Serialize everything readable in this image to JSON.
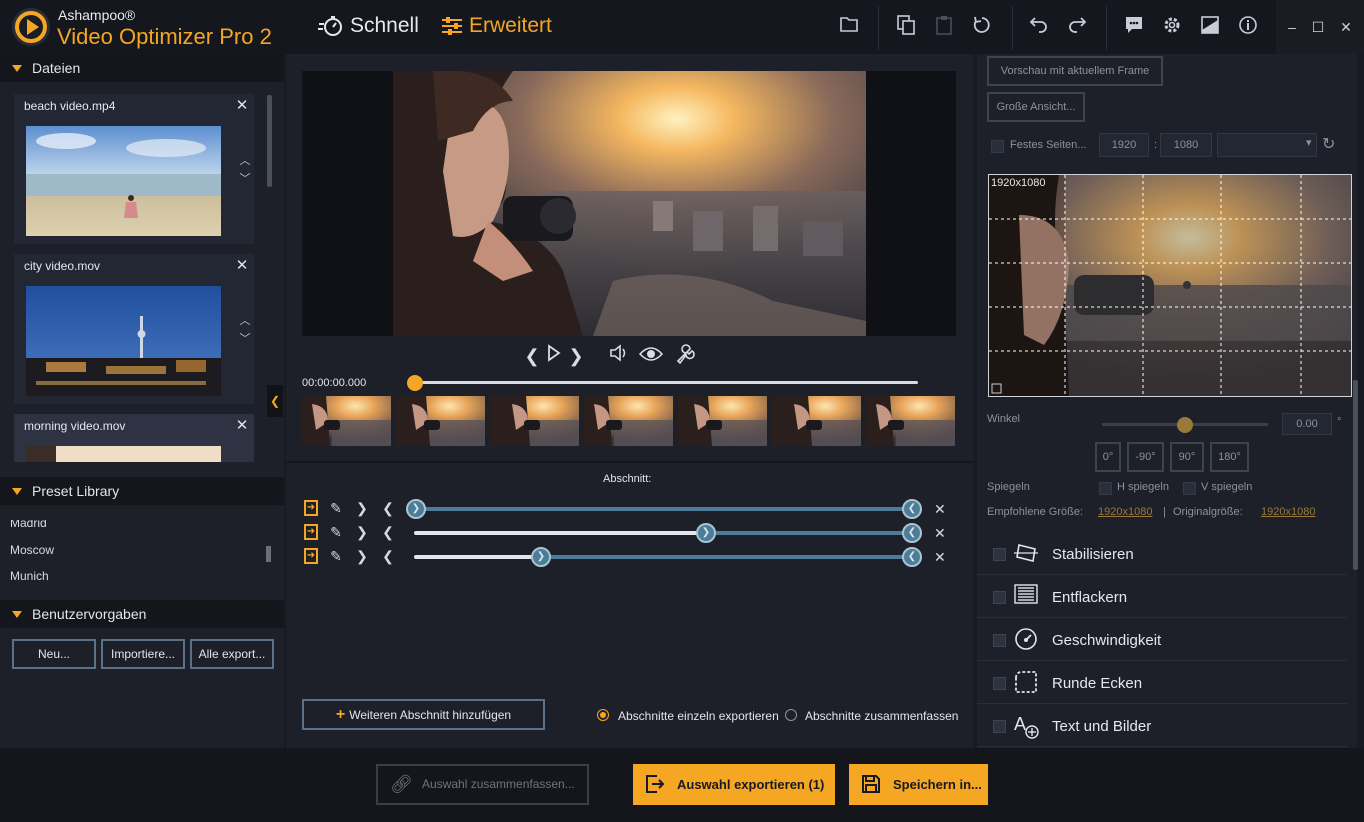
{
  "app": {
    "brand_top": "Ashampoo®",
    "brand_main": "Video Optimizer Pro 2",
    "tabs": [
      {
        "label": "Schnell",
        "icon": "stopwatch-icon"
      },
      {
        "label": "Erweitert",
        "icon": "sliders-icon"
      }
    ],
    "accent_color": "#f5a623"
  },
  "toolbar_icons": [
    "folder-icon",
    "copy-icon",
    "clipboard-icon",
    "reset-icon",
    "undo-icon",
    "redo-icon",
    "chat-icon",
    "gear-icon",
    "image-icon",
    "info-icon"
  ],
  "left": {
    "files_header": "Dateien",
    "files": [
      {
        "name": "beach video.mp4"
      },
      {
        "name": "city video.mov"
      },
      {
        "name": "morning video.mov"
      }
    ],
    "preset_header": "Preset Library",
    "presets": [
      "Madrid",
      "Moscow",
      "Munich"
    ],
    "user_header": "Benutzervorgaben",
    "buttons": {
      "new": "Neu...",
      "import": "Importiere...",
      "export": "Alle export..."
    }
  },
  "center": {
    "timecode": "00:00:00.000",
    "playback_progress": 0,
    "section_label": "Abschnitt:",
    "segments": [
      {
        "start": 0.0,
        "end": 1.0
      },
      {
        "start": 0.58,
        "end": 1.0
      },
      {
        "start": 0.25,
        "end": 1.0
      }
    ],
    "add_section": "Weiteren Abschnitt hinzufügen",
    "radio_separate": "Abschnitte einzeln exportieren",
    "radio_merge": "Abschnitte zusammenfassen",
    "radio_selected": "separate"
  },
  "right": {
    "preview_frame_btn": "Vorschau mit aktuellem Frame",
    "large_view_btn": "Große Ansicht...",
    "fixed_ratio_label": "Festes Seiten...",
    "width": "1920",
    "colon": ":",
    "height": "1080",
    "crop_label": "1920x1080",
    "angle_label": "Winkel",
    "angle_value": "0.00",
    "degree_symbol": "°",
    "angle_level": 0.5,
    "angle_buttons": [
      "0°",
      "-90°",
      "90°",
      "180°"
    ],
    "mirror_label": "Spiegeln",
    "h_mirror": "H spiegeln",
    "v_mirror": "V spiegeln",
    "recommended_label": "Empfohlene Größe:",
    "recommended_value": "1920x1080",
    "separator": "|",
    "original_label": "Originalgröße:",
    "original_value": "1920x1080",
    "features": [
      {
        "label": "Stabilisieren",
        "icon": "stabilize-icon"
      },
      {
        "label": "Entflackern",
        "icon": "deflicker-icon"
      },
      {
        "label": "Geschwindigkeit",
        "icon": "speedometer-icon"
      },
      {
        "label": "Runde Ecken",
        "icon": "rounded-corners-icon"
      },
      {
        "label": "Text und Bilder",
        "icon": "text-image-icon"
      }
    ]
  },
  "bottom": {
    "merge": "Auswahl zusammenfassen...",
    "export": "Auswahl exportieren (1)",
    "save": "Speichern in..."
  }
}
